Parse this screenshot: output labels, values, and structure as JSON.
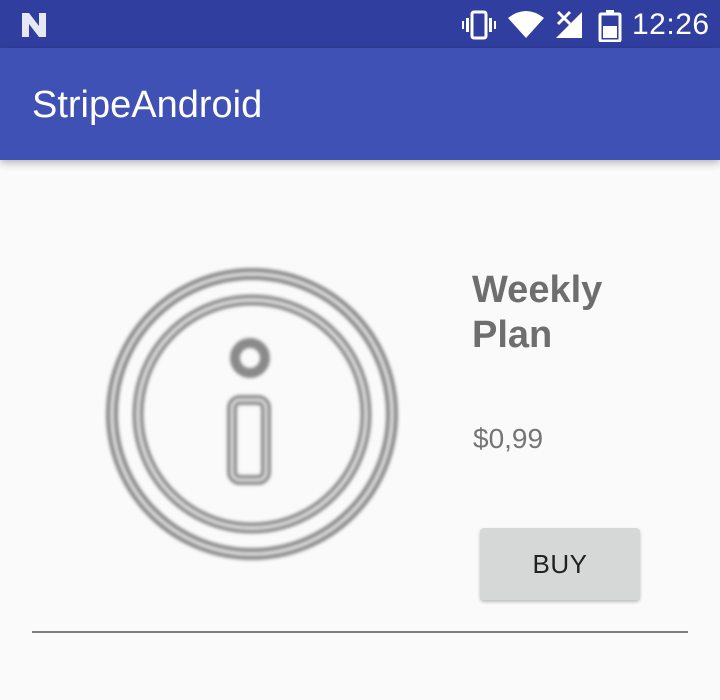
{
  "status_bar": {
    "time": "12:26",
    "icons": [
      "android-n-notification-icon",
      "vibrate-icon",
      "wifi-icon",
      "signal-no-sim-icon",
      "battery-saver-icon"
    ]
  },
  "app_bar": {
    "title": "StripeAndroid"
  },
  "product": {
    "image_icon": "info-circle-icon",
    "name": "Weekly Plan",
    "price": "$0,99",
    "buy_label": "BUY"
  },
  "colors": {
    "status_bar": "#303f9f",
    "app_bar": "#3f51b5",
    "background": "#fafafa",
    "button": "#d6d7d7",
    "plan_text": "#6e6e6e"
  }
}
